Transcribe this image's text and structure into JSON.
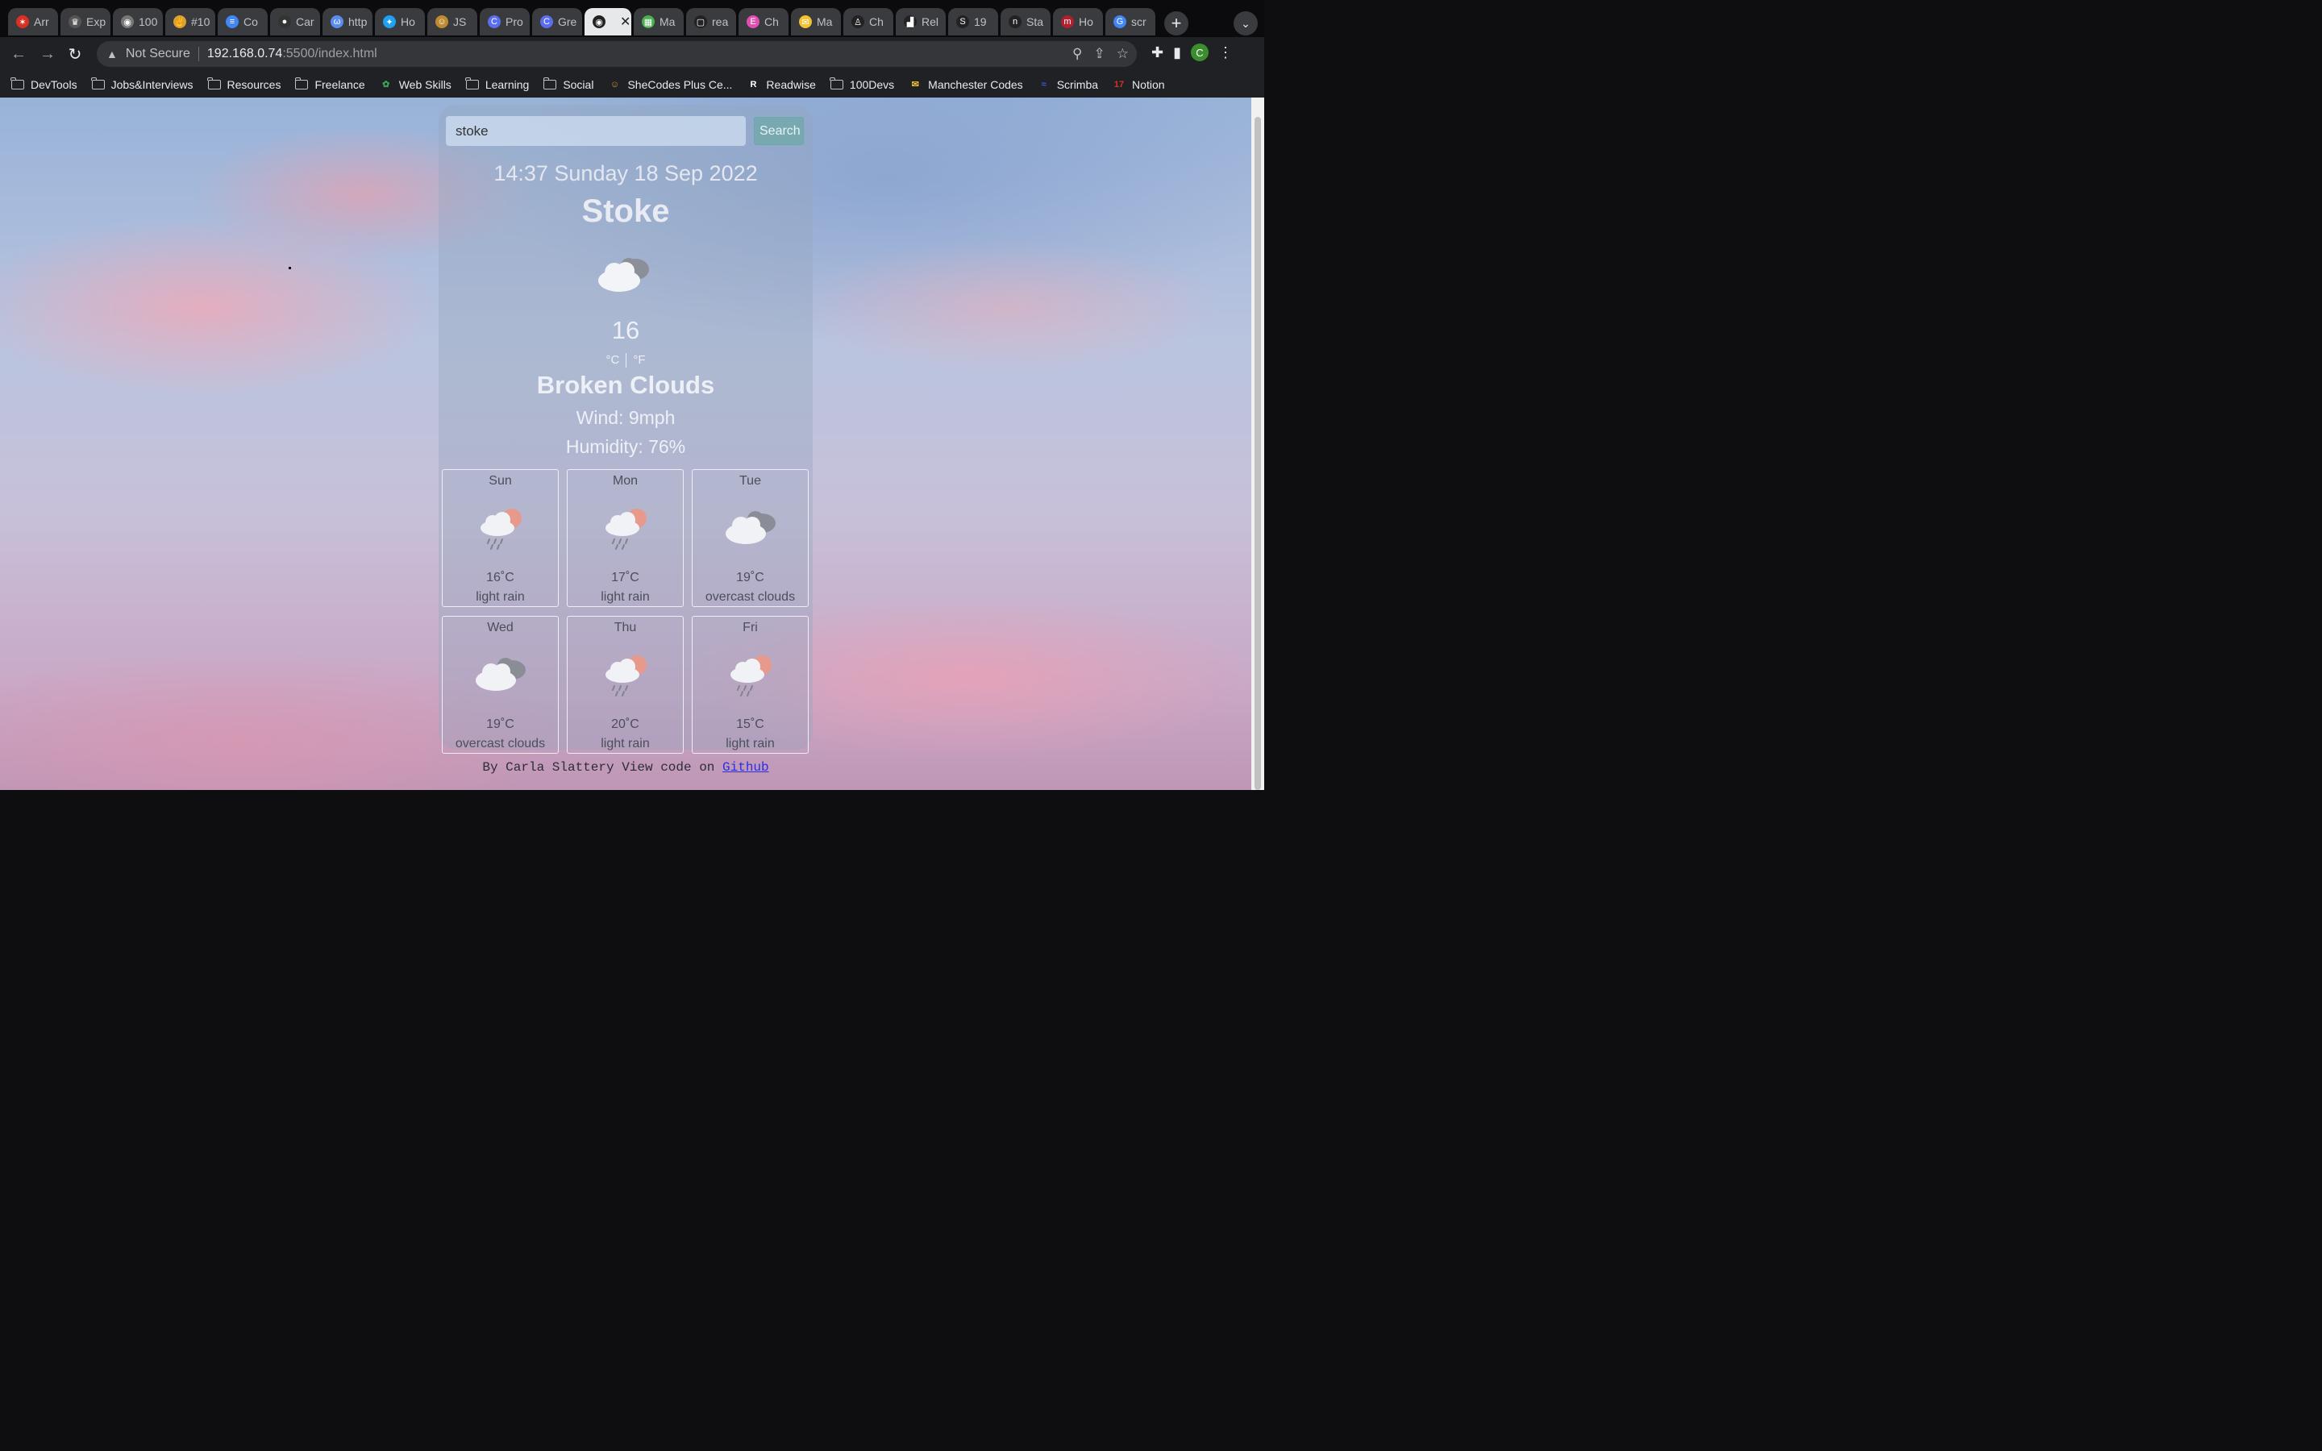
{
  "browser": {
    "tabs": [
      {
        "label": "Arr",
        "color": "#d93025",
        "glyph": "✶"
      },
      {
        "label": "Exp",
        "color": "#555555",
        "glyph": "♛"
      },
      {
        "label": "100",
        "color": "#777777",
        "glyph": "◉"
      },
      {
        "label": "#10",
        "color": "#e0a030",
        "glyph": "✌"
      },
      {
        "label": "Co",
        "color": "#4285f4",
        "glyph": "≡"
      },
      {
        "label": "Car",
        "color": "#333333",
        "glyph": "●"
      },
      {
        "label": "http",
        "color": "#5b8def",
        "glyph": "ω"
      },
      {
        "label": "Ho",
        "color": "#1da1f2",
        "glyph": "✦"
      },
      {
        "label": "JS",
        "color": "#c08a30",
        "glyph": "☺"
      },
      {
        "label": "Pro",
        "color": "#5b6ef0",
        "glyph": "C"
      },
      {
        "label": "Gre",
        "color": "#5b6ef0",
        "glyph": "C"
      },
      {
        "label": "",
        "color": "#222222",
        "glyph": "◉",
        "active": true
      },
      {
        "label": "Ma",
        "color": "#4caf50",
        "glyph": "▦"
      },
      {
        "label": "rea",
        "color": "#222222",
        "glyph": "▢"
      },
      {
        "label": "Ch",
        "color": "#e04fb0",
        "glyph": "E"
      },
      {
        "label": "Ma",
        "color": "#f2c230",
        "glyph": "✉"
      },
      {
        "label": "Ch",
        "color": "#222222",
        "glyph": "♙"
      },
      {
        "label": "Rel",
        "color": "#222222",
        "glyph": "▟"
      },
      {
        "label": "19",
        "color": "#222222",
        "glyph": "S"
      },
      {
        "label": "Sta",
        "color": "#222222",
        "glyph": "n"
      },
      {
        "label": "Ho",
        "color": "#b02030",
        "glyph": "m"
      },
      {
        "label": "scr",
        "color": "#4285f4",
        "glyph": "G"
      }
    ],
    "address": {
      "security_label": "Not Secure",
      "host": "192.168.0.74",
      "path": ":5500/index.html"
    },
    "profile_initial": "C",
    "bookmarks": [
      {
        "label": "DevTools",
        "type": "folder"
      },
      {
        "label": "Jobs&Interviews",
        "type": "folder"
      },
      {
        "label": "Resources",
        "type": "folder"
      },
      {
        "label": "Freelance",
        "type": "folder"
      },
      {
        "label": "Web Skills",
        "type": "site",
        "color": "#3aa655",
        "glyph": "✿"
      },
      {
        "label": "Learning",
        "type": "folder"
      },
      {
        "label": "Social",
        "type": "folder"
      },
      {
        "label": "SheCodes Plus Ce...",
        "type": "site",
        "color": "#d19a3a",
        "glyph": "☺"
      },
      {
        "label": "Readwise",
        "type": "site",
        "color": "#ffffff",
        "glyph": "R"
      },
      {
        "label": "100Devs",
        "type": "folder"
      },
      {
        "label": "Manchester Codes",
        "type": "site",
        "color": "#f2c230",
        "glyph": "✉"
      },
      {
        "label": "Scrimba",
        "type": "site",
        "color": "#3b5bdb",
        "glyph": "≈"
      },
      {
        "label": "Notion",
        "type": "site",
        "color": "#d93025",
        "glyph": "17"
      }
    ]
  },
  "app": {
    "search": {
      "value": "stoke",
      "button_label": "Search"
    },
    "datetime": "14:37 Sunday 18 Sep 2022",
    "city": "Stoke",
    "current_icon": "broken-clouds",
    "temperature": "16",
    "unit_c": "°C",
    "unit_f": "°F",
    "description": "Broken Clouds",
    "wind": "Wind: 9mph",
    "humidity": "Humidity: 76%",
    "forecast": [
      {
        "day": "Sun",
        "temp": "16˚C",
        "desc": "light rain",
        "icon": "light-rain"
      },
      {
        "day": "Mon",
        "temp": "17˚C",
        "desc": "light rain",
        "icon": "light-rain"
      },
      {
        "day": "Tue",
        "temp": "19˚C",
        "desc": "overcast clouds",
        "icon": "overcast-clouds"
      },
      {
        "day": "Wed",
        "temp": "19˚C",
        "desc": "overcast clouds",
        "icon": "overcast-clouds"
      },
      {
        "day": "Thu",
        "temp": "20˚C",
        "desc": "light rain",
        "icon": "light-rain"
      },
      {
        "day": "Fri",
        "temp": "15˚C",
        "desc": "light rain",
        "icon": "light-rain"
      }
    ],
    "footer": {
      "text": "By Carla Slattery View code on ",
      "link": "Github"
    }
  }
}
